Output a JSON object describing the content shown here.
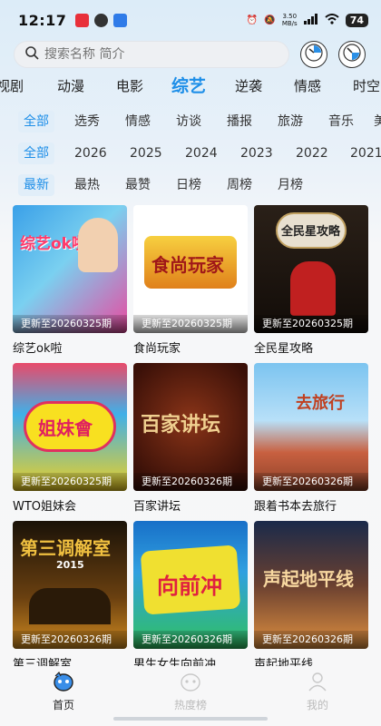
{
  "status": {
    "time": "12:17",
    "speed_value": "3.50",
    "speed_unit": "MB/s",
    "battery": "74"
  },
  "search": {
    "placeholder": "搜索名称 简介"
  },
  "tabs": [
    "视剧",
    "动漫",
    "电影",
    "综艺",
    "逆袭",
    "情感",
    "时空"
  ],
  "active_tab": "综艺",
  "genres": [
    "全部",
    "选秀",
    "情感",
    "访谈",
    "播报",
    "旅游",
    "音乐",
    "美"
  ],
  "years": [
    "全部",
    "2026",
    "2025",
    "2024",
    "2023",
    "2022",
    "2021"
  ],
  "sorts": [
    "最新",
    "最热",
    "最赞",
    "日榜",
    "周榜",
    "月榜"
  ],
  "cards": [
    {
      "title": "综艺ok啦",
      "badge": "更新至20260325期",
      "poster_text": "综艺ok啦",
      "color1": "#3aa0e8",
      "color2": "#e84aa0"
    },
    {
      "title": "食尚玩家",
      "badge": "更新至20260325期",
      "poster_text": "食尚玩家",
      "color1": "#ffffff",
      "color2": "#f0c030"
    },
    {
      "title": "全民星攻略",
      "badge": "更新至20260325期",
      "poster_text": "全民星攻略",
      "color1": "#1a1410",
      "color2": "#c02020"
    },
    {
      "title": "WTO姐妹会",
      "badge": "更新至20260325期",
      "poster_text": "姐妹會",
      "color1": "#40b0e8",
      "color2": "#f0d020"
    },
    {
      "title": "百家讲坛",
      "badge": "更新至20260326期",
      "poster_text": "百家讲坛",
      "color1": "#7a2a14",
      "color2": "#3a1008"
    },
    {
      "title": "跟着书本去旅行",
      "badge": "更新至20260326期",
      "poster_text": "去旅行",
      "color1": "#7cc4f0",
      "color2": "#c86040"
    },
    {
      "title": "第三调解室",
      "badge": "更新至20260326期",
      "poster_text": "第三调解室",
      "sub_text": "2015",
      "color1": "#1a1208",
      "color2": "#d08a20"
    },
    {
      "title": "男生女生向前冲",
      "badge": "更新至20260326期",
      "poster_text": "向前冲",
      "color1": "#1870c8",
      "color2": "#30c060"
    },
    {
      "title": "声起地平线",
      "badge": "更新至20260326期",
      "poster_text": "声起地平线",
      "color1": "#1a2a4a",
      "color2": "#e09040"
    }
  ],
  "bottom_nav": [
    {
      "label": "首页",
      "icon": "home-icon",
      "active": true
    },
    {
      "label": "热度榜",
      "icon": "hot-icon",
      "active": false
    },
    {
      "label": "我的",
      "icon": "profile-icon",
      "active": false
    }
  ]
}
